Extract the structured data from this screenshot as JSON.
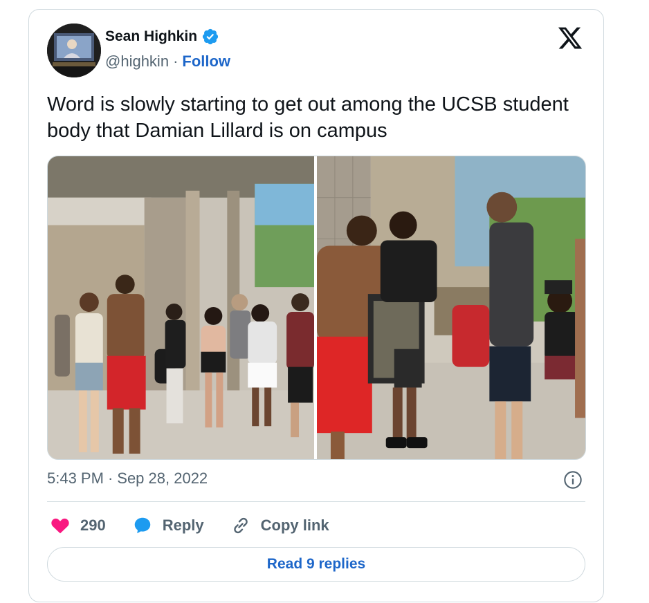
{
  "author": {
    "display_name": "Sean Highkin",
    "handle": "@highkin",
    "separator": "·",
    "follow_label": "Follow",
    "verified": true
  },
  "tweet": {
    "text": "Word is slowly starting to get out among the UCSB student body that Damian Lillard is on campus",
    "time": "5:43 PM",
    "date_separator": "·",
    "date": "Sep 28, 2022"
  },
  "actions": {
    "likes_count": "290",
    "reply_label": "Reply",
    "copy_link_label": "Copy link"
  },
  "footer": {
    "read_replies_label": "Read 9 replies"
  },
  "colors": {
    "accent": "#1d66c9",
    "like": "#f91880",
    "reply_icon": "#1d9bf0",
    "muted": "#536471",
    "border": "#cfd9de"
  },
  "icons": [
    "verified-badge-icon",
    "x-logo-icon",
    "info-icon",
    "heart-icon",
    "reply-bubble-icon",
    "link-icon"
  ]
}
